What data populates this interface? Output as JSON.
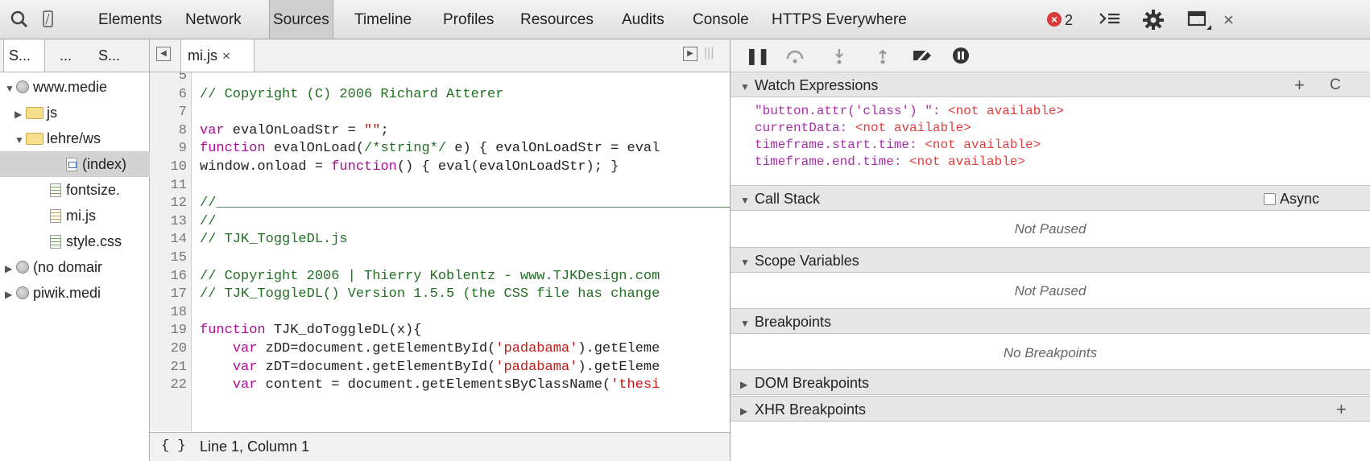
{
  "toolbar": {
    "tabs": [
      "Elements",
      "Network",
      "Sources",
      "Timeline",
      "Profiles",
      "Resources",
      "Audits",
      "Console",
      "HTTPS Everywhere"
    ],
    "selected_tab": "Sources",
    "error_count": "2",
    "close_label": "×"
  },
  "navigator": {
    "tabs": [
      "S...",
      "...",
      "S..."
    ],
    "tree": [
      {
        "label": "www.medie",
        "type": "domain",
        "expanded": true
      },
      {
        "label": "js",
        "type": "folder",
        "expanded": false
      },
      {
        "label": "lehre/ws",
        "type": "folder",
        "expanded": true
      },
      {
        "label": "(index)",
        "type": "html",
        "selected": true
      },
      {
        "label": "fontsize.",
        "type": "css"
      },
      {
        "label": "mi.js",
        "type": "js"
      },
      {
        "label": "style.css",
        "type": "css"
      },
      {
        "label": "(no domair",
        "type": "domain",
        "expanded": false
      },
      {
        "label": "piwik.medi",
        "type": "domain",
        "expanded": false
      }
    ]
  },
  "editor": {
    "open_file": "mi.js",
    "close_label": "×",
    "lines": [
      {
        "n": "5",
        "parts": []
      },
      {
        "n": "6",
        "parts": [
          [
            "c",
            "// Copyright (C) 2006 Richard Atterer"
          ]
        ]
      },
      {
        "n": "7",
        "parts": []
      },
      {
        "n": "8",
        "parts": [
          [
            "k",
            "var"
          ],
          [
            "t",
            " evalOnLoadStr = "
          ],
          [
            "s",
            "\"\""
          ],
          [
            "t",
            ";"
          ]
        ]
      },
      {
        "n": "9",
        "parts": [
          [
            "k",
            "function"
          ],
          [
            "t",
            " evalOnLoad("
          ],
          [
            "c",
            "/*string*/"
          ],
          [
            "t",
            " e) { evalOnLoadStr = eval"
          ]
        ]
      },
      {
        "n": "10",
        "parts": [
          [
            "t",
            "window.onload = "
          ],
          [
            "k",
            "function"
          ],
          [
            "t",
            "() { eval(evalOnLoadStr); }"
          ]
        ]
      },
      {
        "n": "11",
        "parts": []
      },
      {
        "n": "12",
        "parts": [
          [
            "c",
            "//________________________________________________________________"
          ]
        ]
      },
      {
        "n": "13",
        "parts": [
          [
            "c",
            "//"
          ]
        ]
      },
      {
        "n": "14",
        "parts": [
          [
            "c",
            "// TJK_ToggleDL.js"
          ]
        ]
      },
      {
        "n": "15",
        "parts": []
      },
      {
        "n": "16",
        "parts": [
          [
            "c",
            "// Copyright 2006 | Thierry Koblentz - www.TJKDesign.com"
          ]
        ]
      },
      {
        "n": "17",
        "parts": [
          [
            "c",
            "// TJK_ToggleDL() Version 1.5.5 (the CSS file has change"
          ]
        ]
      },
      {
        "n": "18",
        "parts": []
      },
      {
        "n": "19",
        "parts": [
          [
            "k",
            "function"
          ],
          [
            "t",
            " TJK_doToggleDL(x){"
          ]
        ]
      },
      {
        "n": "20",
        "parts": [
          [
            "t",
            "    "
          ],
          [
            "k",
            "var"
          ],
          [
            "t",
            " zDD=document.getElementById("
          ],
          [
            "s",
            "'padabama'"
          ],
          [
            "t",
            ").getEleme"
          ]
        ]
      },
      {
        "n": "21",
        "parts": [
          [
            "t",
            "    "
          ],
          [
            "k",
            "var"
          ],
          [
            "t",
            " zDT=document.getElementById("
          ],
          [
            "s",
            "'padabama'"
          ],
          [
            "t",
            ").getEleme"
          ]
        ]
      },
      {
        "n": "22",
        "parts": [
          [
            "t",
            "    "
          ],
          [
            "k",
            "var"
          ],
          [
            "t",
            " content = document.getElementsByClassName("
          ],
          [
            "s",
            "'thesi"
          ]
        ]
      }
    ],
    "status": "Line 1, Column 1",
    "format_label": "{ }"
  },
  "sidebar": {
    "watch": {
      "title": "Watch Expressions",
      "add_label": "+",
      "refresh_label": "C",
      "items": [
        {
          "name": "\"button.attr('class') \"",
          "value": "<not available>"
        },
        {
          "name": "currentData",
          "value": "<not available>"
        },
        {
          "name": "timeframe.start.time",
          "value": "<not available>"
        },
        {
          "name": "timeframe.end.time",
          "value": "<not available>"
        }
      ]
    },
    "call_stack": {
      "title": "Call Stack",
      "async_label": "Async",
      "empty": "Not Paused"
    },
    "scope": {
      "title": "Scope Variables",
      "empty": "Not Paused"
    },
    "breakpoints": {
      "title": "Breakpoints",
      "empty": "No Breakpoints"
    },
    "dom_breakpoints": {
      "title": "DOM Breakpoints"
    },
    "xhr_breakpoints": {
      "title": "XHR Breakpoints",
      "add_label": "+"
    }
  }
}
